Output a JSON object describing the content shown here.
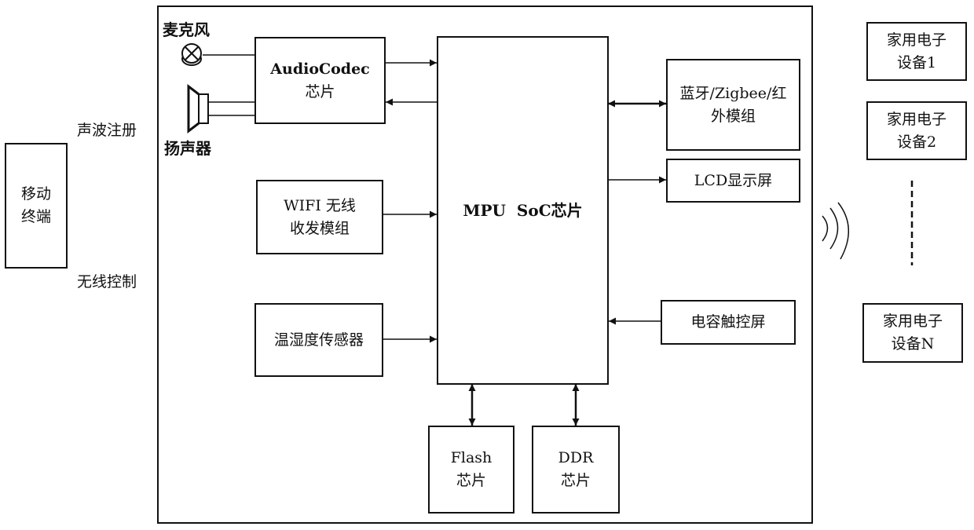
{
  "mobile_terminal": {
    "line1": "移动",
    "line2": "终端"
  },
  "links": {
    "sound_register": "声波注册",
    "wireless_control": "无线控制"
  },
  "microphone": {
    "label": "麦克风",
    "icon": "microphone-icon"
  },
  "speaker": {
    "label": "扬声器",
    "icon": "speaker-icon"
  },
  "audio_codec": {
    "line1": "AudioCodec",
    "line2": "芯片"
  },
  "wifi_module": {
    "line1": "WIFI 无线",
    "line2": "收发模组"
  },
  "temp_humidity_sensor": {
    "label": "温湿度传感器"
  },
  "mpu_soc": {
    "label": "MPU  SoC芯片"
  },
  "bt_zigbee_ir": {
    "line1": "蓝牙/Zigbee/红",
    "line2": "外模组"
  },
  "lcd": {
    "label": "LCD显示屏"
  },
  "touch_screen": {
    "label": "电容触控屏"
  },
  "flash": {
    "line1": "Flash",
    "line2": "芯片"
  },
  "ddr": {
    "line1": "DDR",
    "line2": "芯片"
  },
  "wireless_signal": {
    "icon": "wireless-signal-icon"
  },
  "devices": [
    {
      "line1": "家用电子",
      "line2": "设备1"
    },
    {
      "line1": "家用电子",
      "line2": "设备2"
    },
    {
      "line1": "家用电子",
      "line2": "设备N"
    }
  ]
}
